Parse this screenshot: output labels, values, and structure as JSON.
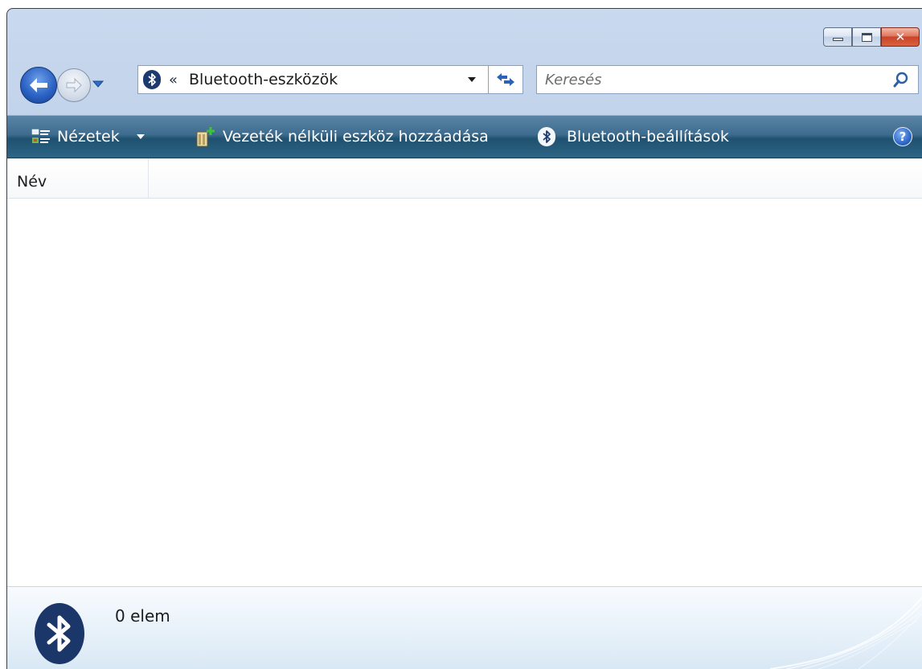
{
  "window": {
    "address": {
      "path_label": "Bluetooth-eszközök",
      "overflow_glyph": "«"
    },
    "search": {
      "placeholder": "Keresés"
    },
    "caption": {
      "close_glyph": "✕"
    }
  },
  "toolbar": {
    "views_label": "Nézetek",
    "add_device_label": "Vezeték nélküli eszköz hozzáadása",
    "settings_label": "Bluetooth-beállítások",
    "help_glyph": "?"
  },
  "list": {
    "columns": [
      "Név"
    ],
    "items": []
  },
  "details": {
    "count_label": "0 elem"
  },
  "icons": [
    "back-arrow-icon",
    "forward-arrow-icon",
    "bluetooth-icon",
    "refresh-icon",
    "search-icon",
    "views-icon",
    "add-device-icon",
    "help-icon"
  ],
  "colors": {
    "command_bar": "#2e6585",
    "bluetooth_badge": "#1b3769",
    "back_button": "#2c63c4"
  }
}
